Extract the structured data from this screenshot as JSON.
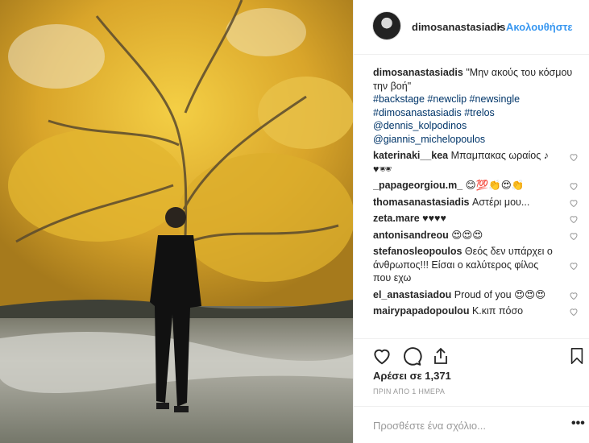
{
  "post": {
    "username": "dimosanastasiadis",
    "separator": "•",
    "follow_label": "Ακολουθήστε"
  },
  "caption": {
    "username": "dimosanastasiadis",
    "text": "\"Μην ακούς του κόσμου την βοή\"",
    "hashtags": [
      "#backstage",
      "#newclip",
      "#newsingle",
      "#dimosanastasiadis",
      "#trelos"
    ],
    "mentions": [
      "@dennis_kolpodinos",
      "@giannis_michelopoulos"
    ]
  },
  "comments": [
    {
      "user": "katerinaki__kea",
      "text": "Μπαμπακας ωραίος ♪ ♥🕶"
    },
    {
      "user": "_papageorgiou.m_",
      "text": "😊💯👏😍👏"
    },
    {
      "user": "thomasanastasiadis",
      "text": "Αστέρι μου..."
    },
    {
      "user": "zeta.mare",
      "text": "♥♥♥♥"
    },
    {
      "user": "antonisandreou",
      "text": "😍😍😍"
    },
    {
      "user": "stefanosleopoulos",
      "text": "Θεός δεν υπάρχει ο άνθρωπος!!! Είσαι ο καλύτερος φίλος που εχω"
    },
    {
      "user": "el_anastasiadou",
      "text": "Proud of you 😍😍😍"
    },
    {
      "user": "mairypapadopoulou",
      "text": "Κ.κιπ πόσο"
    }
  ],
  "likes_text": "Αρέσει σε 1,371",
  "timestamp": "ΠΡΙΝ ΑΠΟ 1 ΗΜΕΡΑ",
  "comment_placeholder": "Προσθέστε ένα σχόλιο...",
  "more_label": "•••",
  "colors": {
    "link": "#3897f0",
    "hashtag": "#003569",
    "text": "#262626",
    "muted": "#999999"
  }
}
